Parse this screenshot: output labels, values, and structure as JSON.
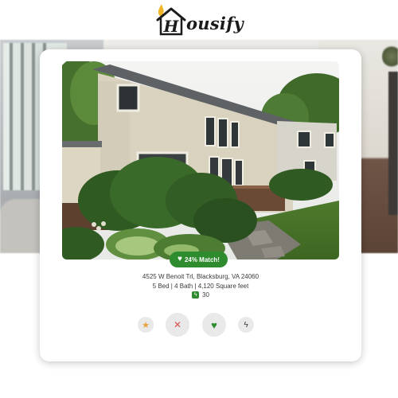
{
  "header": {
    "logo_letter": "H",
    "logo_text": "ousify"
  },
  "listing": {
    "match_label": "24% Match!",
    "address": "4525 W Benoit Trl, Blacksburg, VA 24060",
    "specs": "5 Bed | 4 Bath | 4,120 Square feet",
    "score": "30"
  },
  "icons": {
    "match": "heart-icon",
    "score": "bolt-icon",
    "star": "star-icon",
    "dislike": "close-icon",
    "like": "heart-icon",
    "boost": "bolt-icon"
  },
  "colors": {
    "accent_green": "#2e8b2e",
    "star": "#e8a33d",
    "dislike": "#d9534f",
    "flame": "#f0b429"
  }
}
